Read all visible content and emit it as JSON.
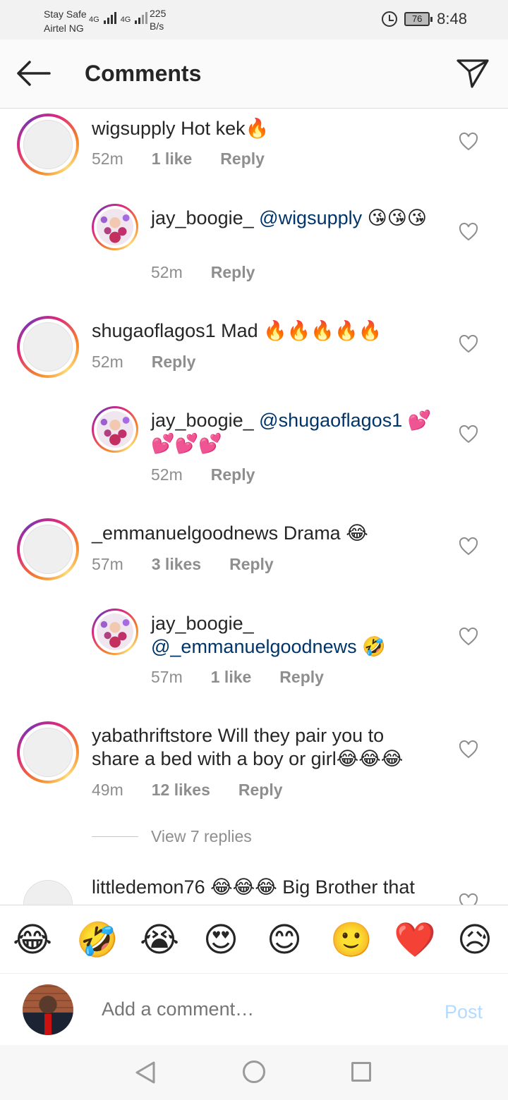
{
  "status_bar": {
    "carrier_line1": "Stay Safe",
    "carrier_line2": "Airtel NG",
    "network1": "4G",
    "network2": "4G",
    "speed_value": "225",
    "speed_unit": "B/s",
    "battery": "76",
    "time": "8:48"
  },
  "header": {
    "title": "Comments"
  },
  "comments": [
    {
      "user": "wigsupply",
      "text": " Hot kek🔥",
      "time": "52m",
      "likes": "1 like",
      "reply": "Reply"
    },
    {
      "user": "jay_boogie_",
      "mention": "@wigsupply",
      "text": " 😘😘😘",
      "time": "52m",
      "reply": "Reply"
    },
    {
      "user": "shugaoflagos1",
      "text": " Mad 🔥🔥🔥🔥🔥",
      "time": "52m",
      "reply": "Reply"
    },
    {
      "user": "jay_boogie_",
      "mention": "@shugaoflagos1",
      "text": " 💕💕💕💕",
      "time": "52m",
      "reply": "Reply"
    },
    {
      "user": "_emmanuelgoodnews",
      "text": " Drama 😂",
      "time": "57m",
      "likes": "3 likes",
      "reply": "Reply"
    },
    {
      "user": "jay_boogie_",
      "mention": "@_emmanuelgoodnews",
      "text": " 🤣",
      "time": "57m",
      "likes": "1 like",
      "reply": "Reply"
    },
    {
      "user": "yabathriftstore",
      "text": " Will they pair you to share a bed with a boy or girl😂😂😂",
      "time": "49m",
      "likes": "12 likes",
      "reply": "Reply"
    },
    {
      "user": "littledemon76",
      "text": " 😂😂😂 Big Brother that"
    }
  ],
  "view_replies": "View 7 replies",
  "emoji_bar": [
    "😂",
    "🤣",
    "😭",
    "😍",
    "😊",
    "🙂",
    "❤️",
    "😥"
  ],
  "composer": {
    "placeholder": "Add a comment…",
    "post_label": "Post"
  },
  "colors": {
    "mention": "#003569",
    "meta": "#8e8e8e",
    "post_disabled": "#b3dbff"
  }
}
